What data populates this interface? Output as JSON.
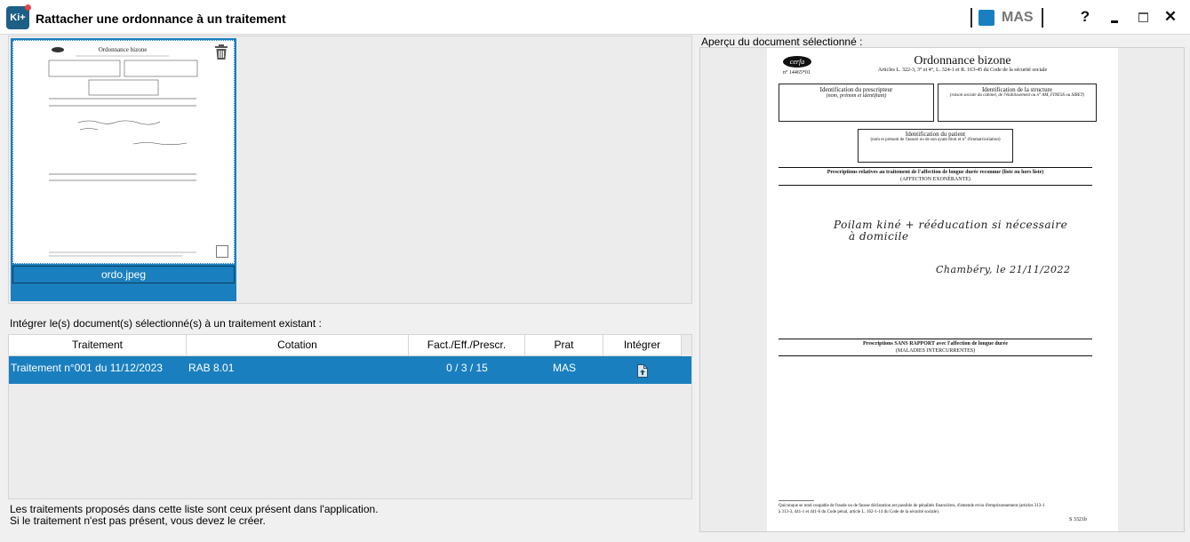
{
  "window": {
    "app_icon_text": "Ki+",
    "title": "Rattacher une ordonnance à un traitement",
    "user": "MAS",
    "help_label": "?",
    "minimize_label": "_",
    "close_label": "✕",
    "accent_color": "#1a7fbe"
  },
  "thumbnail": {
    "file_name": "ordo.jpeg",
    "mini_title": "Ordonnance bizone"
  },
  "integrate": {
    "label": "Intégrer le(s) document(s) sélectionné(s) à un traitement existant :",
    "columns": [
      "Traitement",
      "Cotation",
      "Fact./Eff./Prescr.",
      "Prat",
      "Intégrer"
    ],
    "rows": [
      {
        "traitement": "Traitement n°001 du 11/12/2023",
        "cotation": "RAB 8.01",
        "counts": "0 / 3 / 15",
        "prat": "MAS",
        "integrer_icon": "upload-file-icon"
      }
    ],
    "note_line1": "Les traitements proposés dans cette liste sont ceux présent dans l'application.",
    "note_line2": "Si le traitement n'est pas présent, vous devez le créer."
  },
  "preview": {
    "label": "Aperçu du document sélectionné :",
    "doc": {
      "logo": "cerfa",
      "form_number": "n° 14465*01",
      "title": "Ordonnance bizone",
      "articles": "Articles L. 322-3, 3° et 4°, L. 324-1 et R. 163-45 du Code de la sécurité sociale",
      "prescriber_title": "Identification du prescripteur",
      "prescriber_sub": "(nom, prénom et identifiant)",
      "structure_title": "Identification de la structure",
      "structure_sub": "(raison sociale du cabinet, de l'établissement ou n° AM, FINESS ou SIRET)",
      "patient_title": "Identification du patient",
      "patient_sub": "(nom et prénom de l'assuré ou de son ayant droit et n° d'immatriculation)",
      "section1_title": "Prescriptions relatives au traitement de l'affection de longue durée reconnue (liste ou hors liste)",
      "section1_sub": "(AFFECTION EXONÉRANTE)",
      "handwriting_line1": "Poilam kiné + rééducation si nécessaire",
      "handwriting_line2": "à domicile",
      "handwriting_line3": "Chambéry, le 21/11/2022",
      "section2_title": "Prescriptions SANS RAPPORT avec l'affection de longue durée",
      "section2_sub": "(MALADIES INTERCURRENTES)",
      "footer_line1": "Quiconque se rend coupable de fraude ou de fausse déclaration est passible de pénalités financières, d'amende et/ou d'emprisonnement (articles 313-1",
      "footer_line2": "à 313-3, 441-1 et 441-6 du Code pénal, article L. 162-1-14 du Code de la sécurité sociale).",
      "form_code": "S 3321b"
    }
  }
}
